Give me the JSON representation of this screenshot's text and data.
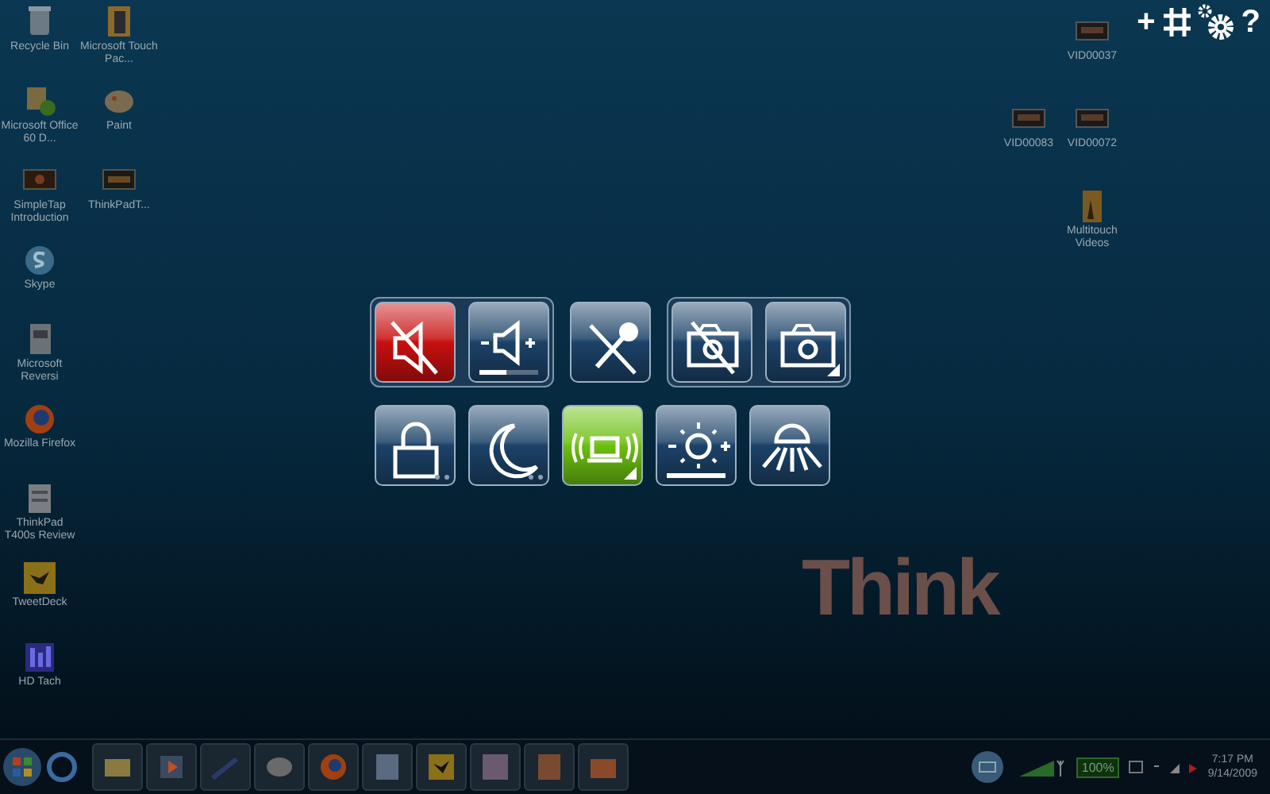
{
  "desktop_left": [
    {
      "label": "Recycle Bin"
    },
    {
      "label": "Microsoft Touch Pac..."
    },
    {
      "label": "Microsoft Office 60 D..."
    },
    {
      "label": "Paint"
    },
    {
      "label": "SimpleTap Introduction"
    },
    {
      "label": "ThinkPadT..."
    },
    {
      "label": "Skype"
    },
    {
      "label": "Microsoft Reversi"
    },
    {
      "label": "Mozilla Firefox"
    },
    {
      "label": "ThinkPad T400s Review"
    },
    {
      "label": "TweetDeck"
    },
    {
      "label": "HD Tach"
    }
  ],
  "desktop_right": [
    {
      "label": "VID00037"
    },
    {
      "label": "VID00083"
    },
    {
      "label": "VID00072"
    },
    {
      "label": "Multitouch Videos"
    }
  ],
  "corner_tools": {
    "add": "+",
    "help": "?"
  },
  "control_panel": {
    "rows": [
      {
        "groups": [
          {
            "framed": true,
            "tiles": [
              {
                "kind": "toggle",
                "color": "#c81010",
                "menu_triangle": false,
                "dots": false
              },
              {
                "kind": "slider",
                "color": "#1c4268",
                "level": 0.45,
                "menu_triangle": false,
                "dots": false
              }
            ]
          },
          {
            "framed": false,
            "tiles": [
              {
                "kind": "toggle",
                "color": "#1c4268",
                "menu_triangle": false,
                "dots": false
              }
            ]
          },
          {
            "framed": true,
            "tiles": [
              {
                "kind": "toggle",
                "color": "#1c4268",
                "menu_triangle": false,
                "dots": false
              },
              {
                "kind": "toggle",
                "color": "#1c4268",
                "menu_triangle": true,
                "dots": false
              }
            ]
          }
        ]
      },
      {
        "groups": [
          {
            "framed": false,
            "tiles": [
              {
                "kind": "toggle",
                "color": "#1c4268",
                "menu_triangle": false,
                "dots": true
              },
              {
                "kind": "toggle",
                "color": "#1c4268",
                "menu_triangle": false,
                "dots": true
              },
              {
                "kind": "toggle",
                "color": "#6cc010",
                "menu_triangle": true,
                "dots": false
              },
              {
                "kind": "slider",
                "color": "#1c4268",
                "level": 1,
                "menu_triangle": false,
                "dots": false
              },
              {
                "kind": "toggle",
                "color": "#1c4268",
                "menu_triangle": false,
                "dots": false
              }
            ]
          }
        ]
      }
    ]
  },
  "logo": {
    "text": "Think"
  },
  "tray": {
    "battery": "100%",
    "time": "7:17 PM",
    "date": "9/14/2009"
  }
}
